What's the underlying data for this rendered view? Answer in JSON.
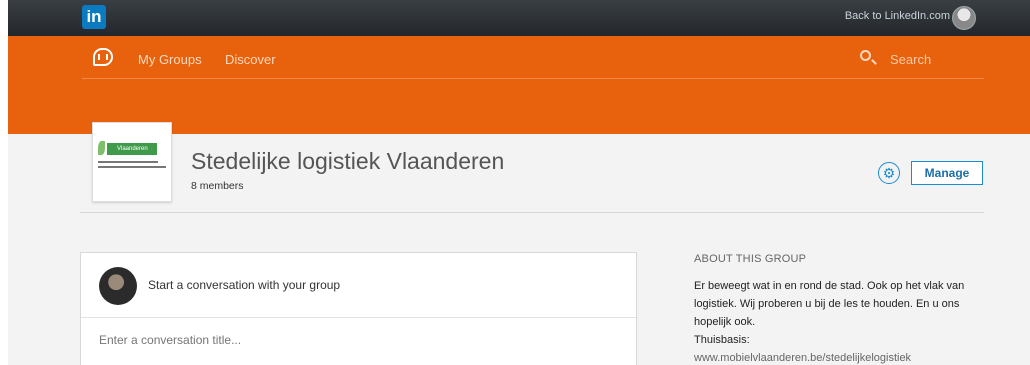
{
  "topbar": {
    "logo_text": "in",
    "back_link": "Back to LinkedIn.com"
  },
  "nav": {
    "my_groups": "My Groups",
    "discover": "Discover",
    "search_placeholder": "Search"
  },
  "group": {
    "logo_text": "Vlaanderen",
    "title": "Stedelijke logistiek Vlaanderen",
    "members": "8 members",
    "manage_label": "Manage",
    "settings_icon": "⚙"
  },
  "conversation": {
    "prompt": "Start a conversation with your group",
    "title_placeholder": "Enter a conversation title..."
  },
  "about": {
    "heading": "ABOUT THIS GROUP",
    "description": "Er beweegt wat in en rond de stad. Ook op het vlak van logistiek. Wij proberen u bij de les te houden. En u ons hopelijk ook.",
    "base_label": "Thuisbasis:",
    "base_link": "www.mobielvlaanderen.be/stedelijkelogistiek"
  },
  "colors": {
    "orange": "#e8620e",
    "accent_blue": "#1a8cd0",
    "topbar": "#2b2f33"
  }
}
